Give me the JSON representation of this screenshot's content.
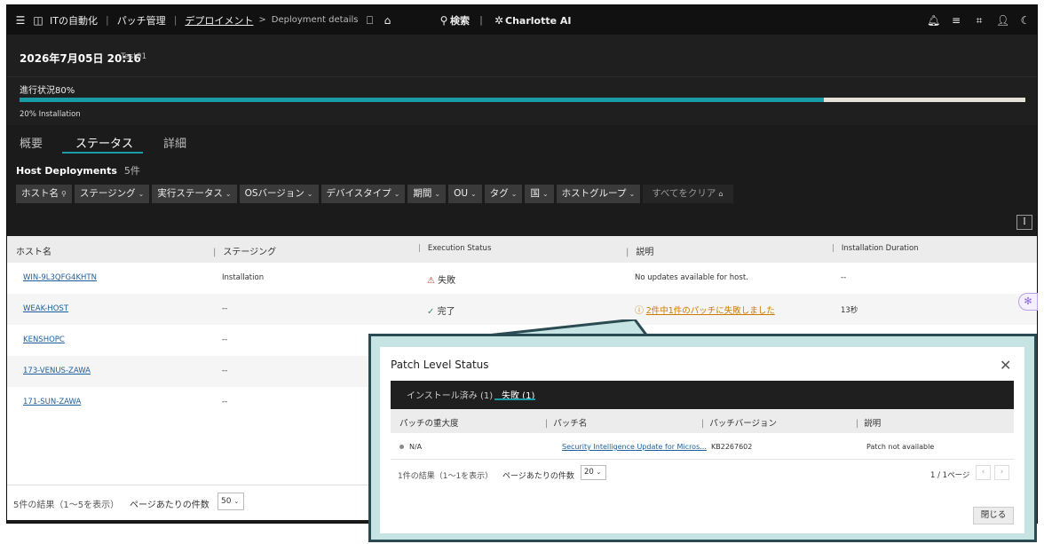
{
  "topbar": {
    "app": "ITの自動化",
    "section": "パッチ管理",
    "crumb_link": "デプロイメント",
    "crumb_current": "Deployment details",
    "search": "検索",
    "assistant": "Charlotte AI"
  },
  "header": {
    "date": "2026年7月05日 20:16",
    "name": "Test01"
  },
  "progress": {
    "label": "進行状況80%",
    "value": 0.8,
    "sub": "20% Installation"
  },
  "tabs": [
    "概要",
    "ステータス",
    "詳細"
  ],
  "host_deployments": {
    "title": "Host Deployments",
    "count": "5件"
  },
  "filters": [
    "ホスト名",
    "ステージング",
    "実行ステータス",
    "OSバージョン",
    "デバイスタイプ",
    "期間",
    "OU",
    "タグ",
    "国",
    "ホストグループ"
  ],
  "clear_all": "すべてをクリア",
  "table": {
    "headers": [
      "ホスト名",
      "ステージング",
      "Execution Status",
      "説明",
      "Installation Duration"
    ],
    "rows": [
      {
        "host": "WIN-9L3QFG4KHTN",
        "staging": "Installation",
        "status": "失敗",
        "desc": "No updates available for host.",
        "duration": "--"
      },
      {
        "host": "WEAK-HOST",
        "staging": "--",
        "status": "完了",
        "desc": "2件中1件のパッチに失敗しました",
        "duration": "13秒"
      },
      {
        "host": "KENSHOPC",
        "staging": "--",
        "status": "",
        "desc": "",
        "duration": ""
      },
      {
        "host": "173-VENUS-ZAWA",
        "staging": "--",
        "status": "",
        "desc": "",
        "duration": ""
      },
      {
        "host": "171-SUN-ZAWA",
        "staging": "--",
        "status": "",
        "desc": "",
        "duration": ""
      }
    ]
  },
  "footer": {
    "results": "5件の結果（1～5を表示）",
    "per_page_label": "ページあたりの件数",
    "per_page": "50"
  },
  "dialog": {
    "title": "Patch Level Status",
    "tabs": [
      "インストール済み (1)",
      "失敗 (1)"
    ],
    "headers": [
      "パッチの重大度",
      "パッチ名",
      "パッチバージョン",
      "説明"
    ],
    "row": {
      "severity": "N/A",
      "name": "Security Intelligence Update for Micros...",
      "version": "KB2267602",
      "desc": "Patch not available"
    },
    "results": "1件の結果（1～1を表示）",
    "per_page_label": "ページあたりの件数",
    "per_page": "20",
    "page": "1 / 1ページ",
    "close": "閉じる"
  },
  "colors": {
    "accent": "#199ca6",
    "warning": "#cc7a00",
    "error": "#c0392b",
    "success": "#3c8d5a"
  }
}
